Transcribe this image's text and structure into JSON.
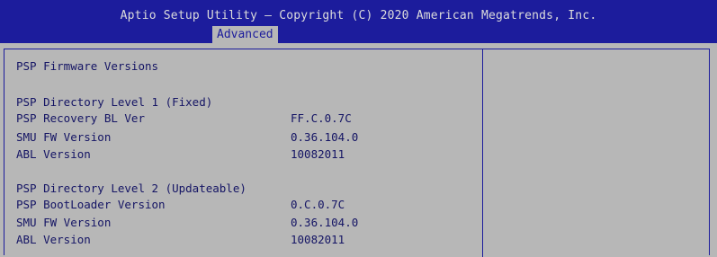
{
  "header": {
    "title": "Aptio Setup Utility – Copyright (C) 2020 American Megatrends, Inc.",
    "active_tab": "Advanced"
  },
  "colors": {
    "header_bg": "#1c1c9c",
    "body_bg": "#b7b7b7",
    "text": "#141464",
    "header_text": "#dcdcdc"
  },
  "main": {
    "section_title": "PSP Firmware Versions",
    "level1": {
      "title": "PSP Directory Level 1 (Fixed)",
      "items": [
        {
          "label": "PSP Recovery BL Ver",
          "value": "FF.C.0.7C"
        },
        {
          "label": "SMU FW Version",
          "value": "0.36.104.0"
        },
        {
          "label": "ABL Version",
          "value": "10082011"
        }
      ]
    },
    "level2": {
      "title": "PSP Directory Level 2 (Updateable)",
      "items": [
        {
          "label": "PSP BootLoader Version",
          "value": "0.C.0.7C"
        },
        {
          "label": "SMU FW Version",
          "value": "0.36.104.0"
        },
        {
          "label": "ABL Version",
          "value": "10082011"
        }
      ]
    }
  }
}
